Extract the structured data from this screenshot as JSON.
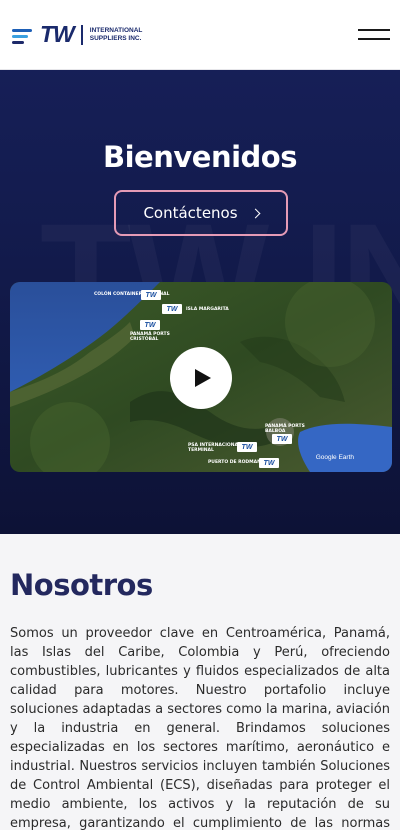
{
  "header": {
    "logo_text": "TW",
    "logo_sub_line1": "International",
    "logo_sub_line2": "Suppliers Inc."
  },
  "hero": {
    "title": "Bienvenidos",
    "cta_label": "Contáctenos",
    "video": {
      "map_labels": [
        "Colón Container Terminal",
        "Isla Margarita",
        "Panamá Ports Cristóbal",
        "Panamá Ports Balboa",
        "PSA Internacional Terminal",
        "Puerto de Rodman (PSA)"
      ],
      "badge_text": "TW",
      "attribution": "Google Earth"
    }
  },
  "about": {
    "heading": "Nosotros",
    "body": "Somos un proveedor clave en Centroamérica, Panamá, las Islas del Caribe, Colombia y Perú, ofreciendo combustibles, lubricantes y fluidos especializados de alta calidad para motores. Nuestro portafolio incluye soluciones adaptadas a sectores como la marina, aviación y la industria en general. Brindamos soluciones especializadas en los sectores marítimo, aeronáutico e industrial. Nuestros servicios incluyen también Soluciones de Control Ambiental (ECS), diseñadas para proteger el medio ambiente, los activos y la reputación de su empresa, garantizando el cumplimiento de las normas internacionales."
  },
  "colors": {
    "brand_navy": "#1a2a6c",
    "hero_bg": "#161f57",
    "cta_border": "#e59bb6",
    "heading": "#23285e"
  }
}
